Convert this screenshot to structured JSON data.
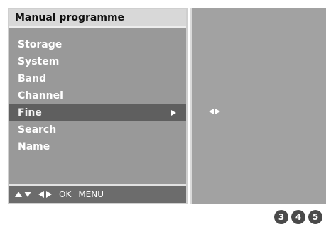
{
  "panel": {
    "title": "Manual programme",
    "items": [
      {
        "label": "Storage"
      },
      {
        "label": "System"
      },
      {
        "label": "Band"
      },
      {
        "label": "Channel"
      },
      {
        "label": "Fine"
      },
      {
        "label": "Search"
      },
      {
        "label": "Name"
      }
    ],
    "selected_index": 4,
    "footer": {
      "ok": "OK",
      "menu": "MENU"
    }
  },
  "steps": [
    "3",
    "4",
    "5"
  ],
  "colors": {
    "panel_bg": "#999999",
    "title_bg": "#d8d8d8",
    "selected_bg": "#5f5f5f",
    "right_bg": "#a2a2a2"
  },
  "icons": {
    "selected_arrow": "arrow-right-icon",
    "fine_indicator": "left-right-arrows-icon"
  }
}
